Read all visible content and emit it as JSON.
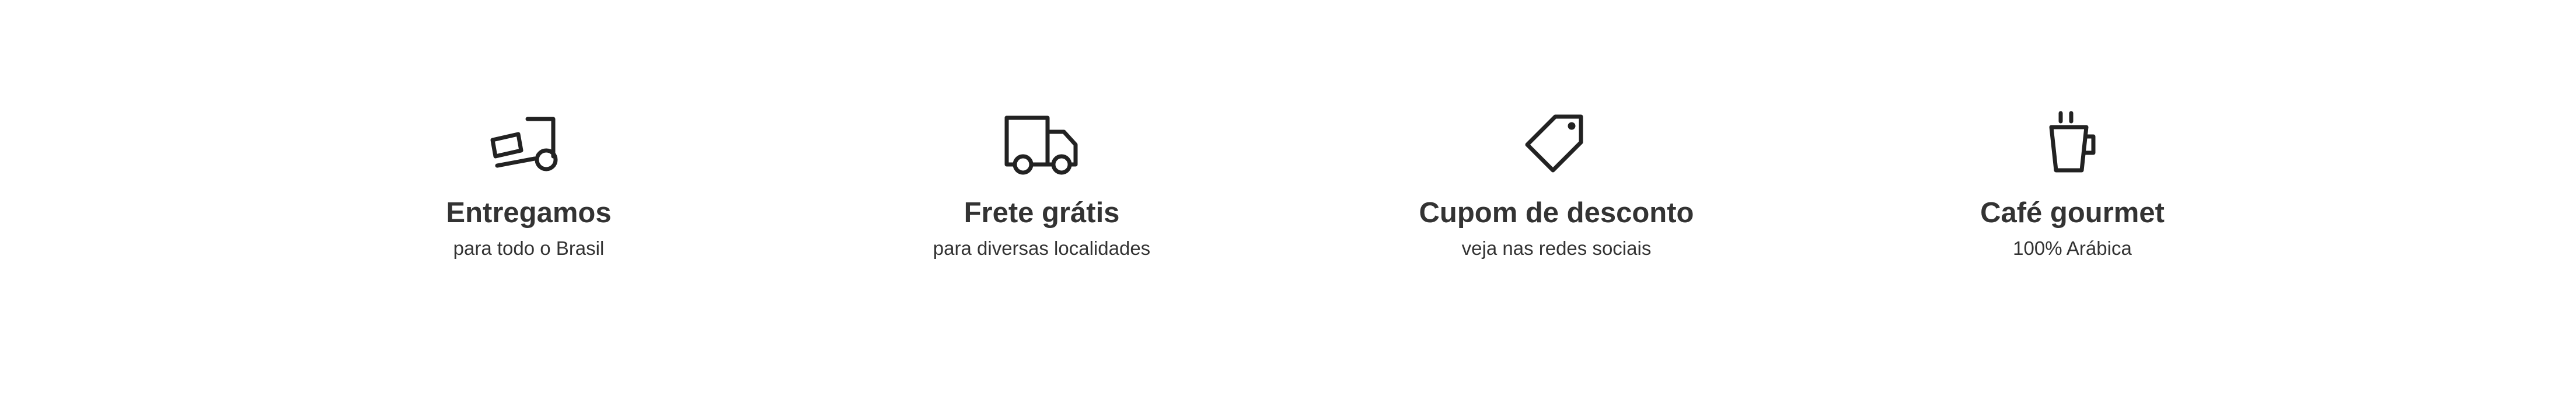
{
  "features": [
    {
      "icon": "dolly-icon",
      "title": "Entregamos",
      "subtitle": "para todo o Brasil"
    },
    {
      "icon": "truck-icon",
      "title": "Frete grátis",
      "subtitle": "para diversas localidades"
    },
    {
      "icon": "tag-icon",
      "title": "Cupom de desconto",
      "subtitle": "veja nas redes sociais"
    },
    {
      "icon": "coffee-cup-icon",
      "title": "Café gourmet",
      "subtitle": "100% Arábica"
    }
  ],
  "colors": {
    "text": "#333333",
    "icon_stroke": "#222222",
    "background": "#ffffff"
  }
}
